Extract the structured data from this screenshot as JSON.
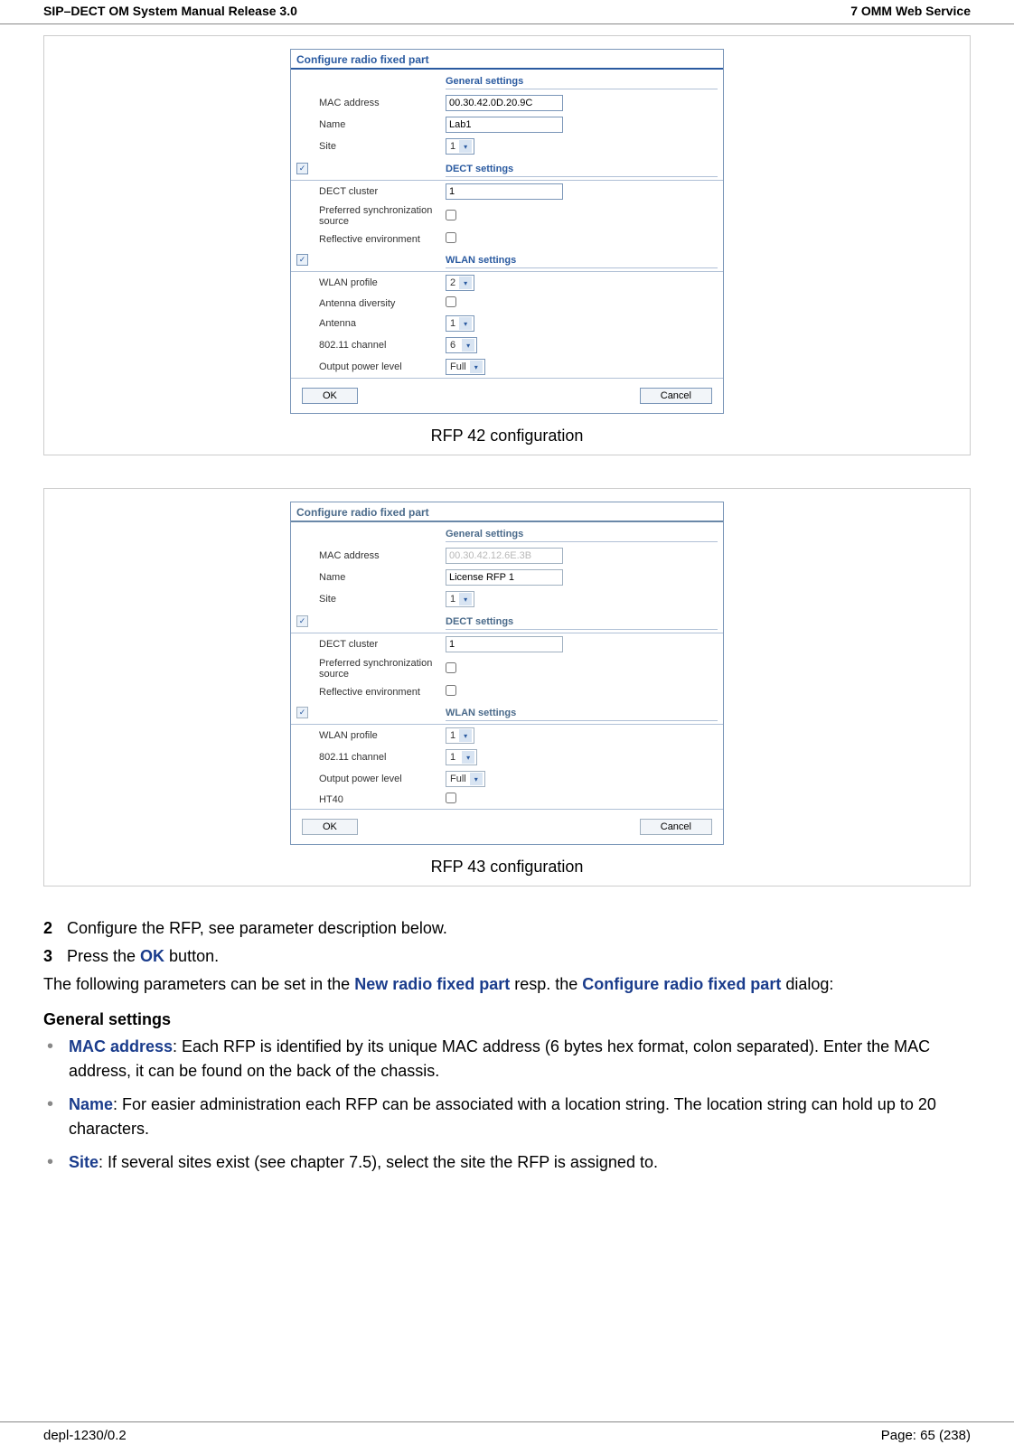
{
  "header": {
    "left": "SIP–DECT OM System Manual Release 3.0",
    "right": "7 OMM Web Service"
  },
  "footer": {
    "left": "depl-1230/0.2",
    "right": "Page: 65 (238)"
  },
  "figure1": {
    "caption": "RFP 42 configuration",
    "title": "Configure radio fixed part",
    "general_head": "General settings",
    "mac_label": "MAC address",
    "mac_value": "00.30.42.0D.20.9C",
    "name_label": "Name",
    "name_value": "Lab1",
    "site_label": "Site",
    "site_value": "1",
    "dect_head": "DECT settings",
    "cluster_label": "DECT cluster",
    "cluster_value": "1",
    "pref_label": "Preferred synchronization source",
    "refl_label": "Reflective environment",
    "wlan_head": "WLAN settings",
    "wlan_profile_label": "WLAN profile",
    "wlan_profile_value": "2",
    "ant_div_label": "Antenna diversity",
    "ant_label": "Antenna",
    "ant_value": "1",
    "chan_label": "802.11 channel",
    "chan_value": "6",
    "power_label": "Output power level",
    "power_value": "Full",
    "ok": "OK",
    "cancel": "Cancel"
  },
  "figure2": {
    "caption": "RFP 43 configuration",
    "title": "Configure radio fixed part",
    "general_head": "General settings",
    "mac_label": "MAC address",
    "mac_value": "00.30.42.12.6E.3B",
    "name_label": "Name",
    "name_value": "License RFP 1",
    "site_label": "Site",
    "site_value": "1",
    "dect_head": "DECT settings",
    "cluster_label": "DECT cluster",
    "cluster_value": "1",
    "pref_label": "Preferred synchronization source",
    "refl_label": "Reflective environment",
    "wlan_head": "WLAN settings",
    "wlan_profile_label": "WLAN profile",
    "wlan_profile_value": "1",
    "chan_label": "802.11 channel",
    "chan_value": "1",
    "power_label": "Output power level",
    "power_value": "Full",
    "ht40_label": "HT40",
    "ok": "OK",
    "cancel": "Cancel"
  },
  "steps": {
    "s2": "Configure the RFP, see parameter description below.",
    "s3_pre": "Press the ",
    "s3_btn": "OK",
    "s3_post": " button."
  },
  "para1": {
    "pre": "The following parameters can be set in the ",
    "b1": "New radio fixed part",
    "mid": " resp. the ",
    "b2": "Configure radio fixed part",
    "post": " dialog:"
  },
  "gensettings_head": "General settings",
  "bul1": {
    "term": "MAC address",
    "text": ": Each RFP is identified by its unique MAC address (6 bytes hex format, colon separated). Enter the MAC address, it can be found on the back of the chassis."
  },
  "bul2": {
    "term": "Name",
    "text": ": For easier administration each RFP can be associated with a location string. The location string can hold up to 20 characters."
  },
  "bul3": {
    "term": "Site",
    "text": ": If several sites exist (see chapter 7.5), select the site the RFP is assigned to."
  }
}
